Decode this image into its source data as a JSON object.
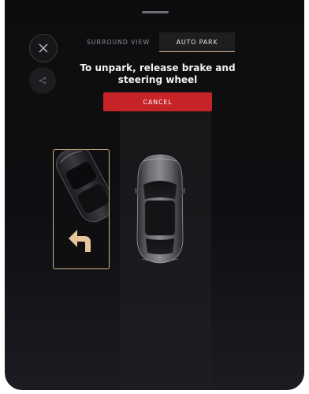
{
  "tabs": {
    "surround": "SURROUND VIEW",
    "autopark": "AUTO PARK",
    "selected": "AUTO PARK"
  },
  "message": {
    "text": "To unpark, release brake and steering wheel"
  },
  "cancel": {
    "label": "CANCEL"
  },
  "icons": {
    "close": "close-icon",
    "share": "share-icon",
    "arrow": "turn-left-arrow-icon",
    "ego_car": "car-icon",
    "parked_car": "parked-car-icon"
  },
  "colors": {
    "accent": "#d2b48a",
    "cancel": "#c7242a",
    "panel": "#0e0f12"
  }
}
